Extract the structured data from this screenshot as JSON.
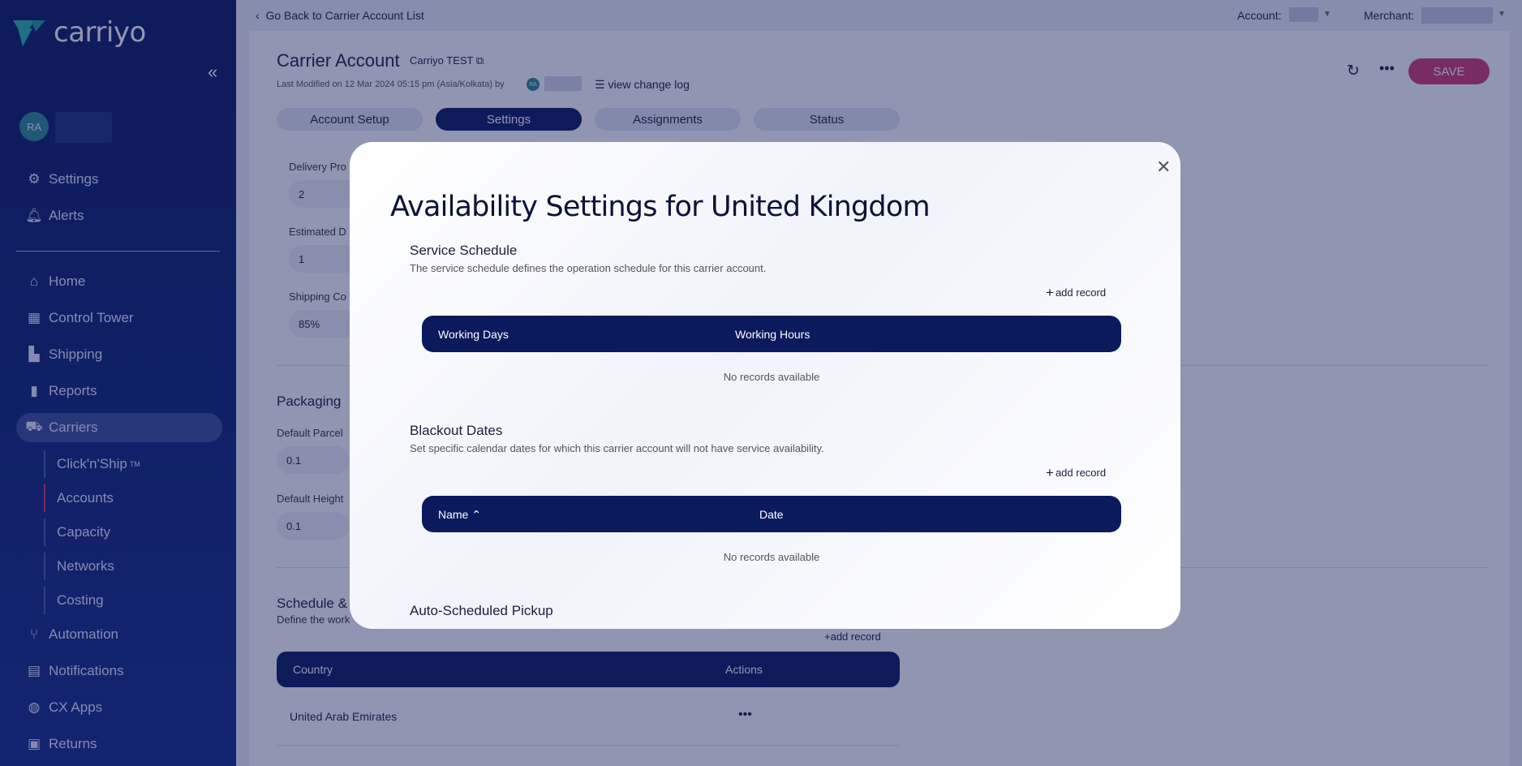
{
  "brand": {
    "name": "carriyo"
  },
  "sidebar": {
    "avatar_initials": "RA",
    "items": [
      {
        "label": "Settings",
        "icon": "gear-icon"
      },
      {
        "label": "Alerts",
        "icon": "bell-icon"
      },
      {
        "label": "Home",
        "icon": "home-icon"
      },
      {
        "label": "Control Tower",
        "icon": "dashboard-icon"
      },
      {
        "label": "Shipping",
        "icon": "boxes-icon"
      },
      {
        "label": "Reports",
        "icon": "bar-chart-icon"
      },
      {
        "label": "Carriers",
        "icon": "truck-icon"
      },
      {
        "label": "Automation",
        "icon": "fork-icon"
      },
      {
        "label": "Notifications",
        "icon": "message-icon"
      },
      {
        "label": "CX Apps",
        "icon": "palette-icon"
      },
      {
        "label": "Returns",
        "icon": "return-box-icon"
      }
    ],
    "sub_items": [
      {
        "label": "Click'n'Ship",
        "suffix": "TM"
      },
      {
        "label": "Accounts"
      },
      {
        "label": "Capacity"
      },
      {
        "label": "Networks"
      },
      {
        "label": "Costing"
      }
    ]
  },
  "topbar": {
    "back_label": "Go Back to Carrier Account List",
    "account_label": "Account:",
    "merchant_label": "Merchant:"
  },
  "page": {
    "title": "Carrier Account",
    "subtitle": "Carriyo TEST",
    "last_modified": "Last Modified on 12 Mar 2024 05:15 pm (Asia/Kolkata) by",
    "mini_avatar": "RA",
    "change_log": "view change log",
    "save_label": "SAVE",
    "tabs": [
      "Account Setup",
      "Settings",
      "Assignments",
      "Status"
    ],
    "fields": [
      {
        "label": "Delivery Pro",
        "value": "2"
      },
      {
        "label": "Estimated D",
        "value": "1"
      },
      {
        "label": "Shipping Co",
        "value": "85%"
      }
    ],
    "packaging": {
      "title": "Packaging",
      "fields": [
        {
          "label": "Default Parcel",
          "value": "0.1"
        },
        {
          "label": "Default Height",
          "value": "0.1"
        }
      ]
    },
    "schedule": {
      "title": "Schedule &",
      "desc": "Define the work",
      "add_label": "add record",
      "col_country": "Country",
      "col_actions": "Actions",
      "row_country": "United Arab Emirates"
    }
  },
  "modal": {
    "title": "Availability Settings for United Kingdom",
    "service_schedule": {
      "title": "Service Schedule",
      "desc": "The service schedule defines the operation schedule for this carrier account.",
      "add_label": "add record",
      "col1": "Working Days",
      "col2": "Working Hours",
      "empty": "No records available"
    },
    "blackout": {
      "title": "Blackout Dates",
      "desc": "Set specific calendar dates for which this carrier account will not have service availability.",
      "add_label": "add record",
      "col1": "Name ⌃",
      "col2": "Date",
      "empty": "No records available"
    },
    "auto_pickup": {
      "title": "Auto-Scheduled Pickup"
    }
  },
  "colors": {
    "navy": "#0a1a5c",
    "accent": "#d43a6a",
    "teal": "#2a8a8e"
  }
}
